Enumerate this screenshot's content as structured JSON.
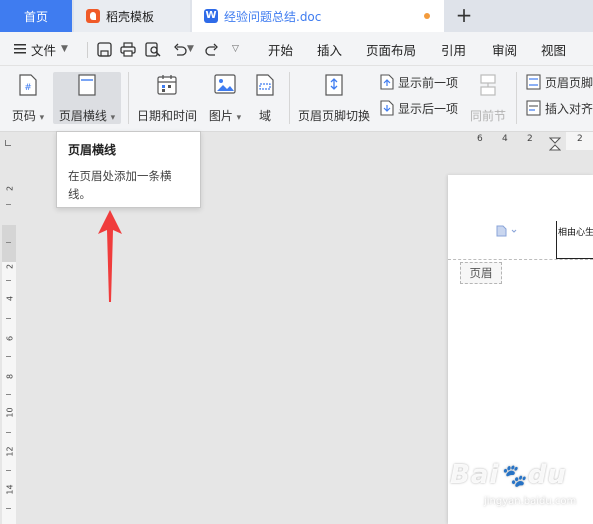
{
  "tabs": {
    "home": "首页",
    "template": "稻壳模板",
    "document": "经验问题总结.doc",
    "document_logo": "W",
    "new_tab": "+"
  },
  "menu": {
    "file": "文件",
    "items": [
      "开始",
      "插入",
      "页面布局",
      "引用",
      "审阅",
      "视图"
    ]
  },
  "ribbon": {
    "page_number": "页码",
    "header_line": "页眉横线",
    "date_time": "日期和时间",
    "picture": "图片",
    "field": "域",
    "header_footer_switch": "页眉页脚切换",
    "show_previous": "显示前一项",
    "show_next": "显示后一项",
    "same_as_previous": "同前节",
    "header_footer_options": "页眉页脚",
    "insert_align_tab": "插入对齐"
  },
  "ruler": {
    "horizontal": [
      "6",
      "4",
      "2",
      "2"
    ],
    "vertical": [
      "2",
      "2",
      "4",
      "6",
      "8",
      "10",
      "12",
      "14"
    ]
  },
  "tooltip": {
    "title": "页眉横线",
    "description": "在页眉处添加一条横线。"
  },
  "page": {
    "header_text": "相由心生",
    "header_tag": "页眉"
  },
  "watermark": {
    "brand": "Bai",
    "paw": "du",
    "sub": "jingyan.baidu.com"
  },
  "colors": {
    "accent": "#3f7cf0",
    "arrow": "#f03c3c",
    "unsaved": "#f39b3c"
  }
}
